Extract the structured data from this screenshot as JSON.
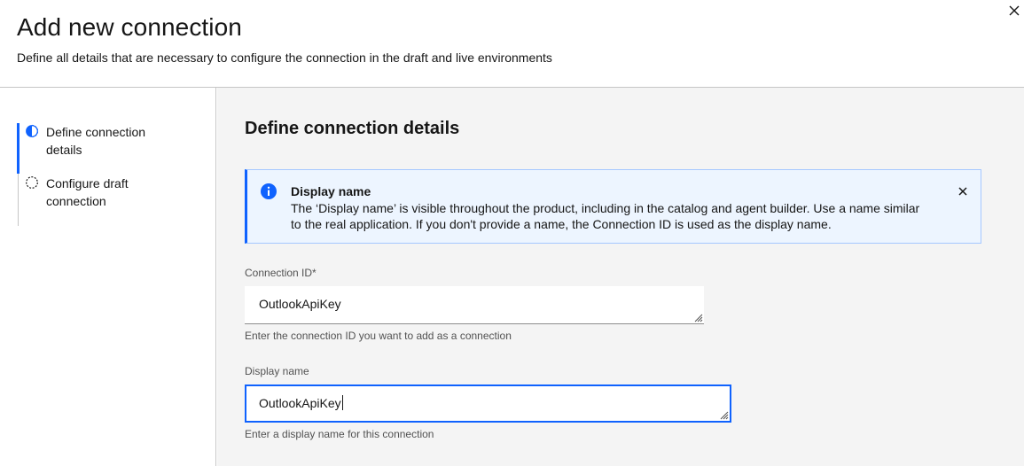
{
  "header": {
    "title": "Add new connection",
    "subtitle": "Define all details that are necessary to configure the connection in the draft and live environments",
    "close_icon": "close-icon"
  },
  "sidebar": {
    "steps": [
      {
        "label": "Define connection details",
        "state": "current",
        "icon": "half-circle-icon"
      },
      {
        "label": "Configure draft connection",
        "state": "incomplete",
        "icon": "dashed-circle-icon"
      }
    ]
  },
  "main": {
    "section_title": "Define connection details",
    "notification": {
      "icon": "info-icon",
      "title": "Display name",
      "body": "The ‘Display name’ is visible throughout the product, including in the catalog and agent builder. Use a name similar to the real application. If you don't provide a name, the Connection ID is used as the display name."
    },
    "fields": {
      "connection_id": {
        "label": "Connection ID*",
        "value": "OutlookApiKey",
        "helper": "Enter the connection ID you want to add as a connection"
      },
      "display_name": {
        "label": "Display name",
        "value": "OutlookApiKey",
        "helper": "Enter a display name for this connection"
      }
    }
  },
  "colors": {
    "accent": "#0f62fe",
    "panel_bg": "#f4f4f4",
    "notification_bg": "#edf5ff"
  }
}
